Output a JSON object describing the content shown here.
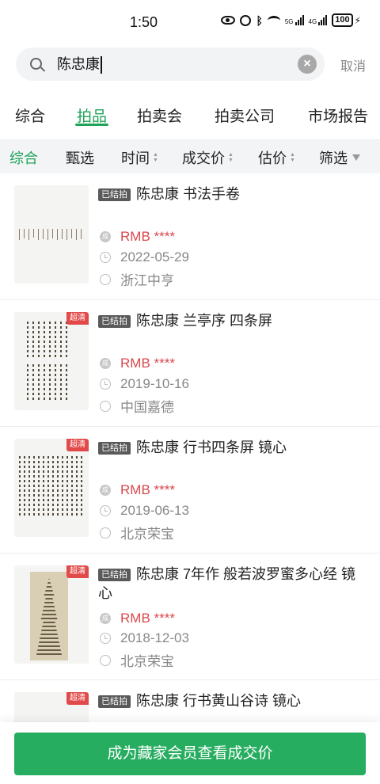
{
  "status_bar": {
    "time": "1:50",
    "network_1": "5G",
    "network_2": "4G",
    "battery": "100"
  },
  "search": {
    "query": "陈忠康",
    "clear_icon": "clear-circle-icon",
    "cancel_label": "取消"
  },
  "tabs": [
    {
      "label": "综合",
      "active": false
    },
    {
      "label": "拍品",
      "active": true
    },
    {
      "label": "拍卖会",
      "active": false
    },
    {
      "label": "拍卖公司",
      "active": false
    },
    {
      "label": "市场报告",
      "active": false
    }
  ],
  "filters": [
    {
      "label": "综合",
      "active": true
    },
    {
      "label": "甄选"
    },
    {
      "label": "时间",
      "sortable": true
    },
    {
      "label": "成交价",
      "sortable": true
    },
    {
      "label": "估价",
      "sortable": true
    },
    {
      "label": "筛选",
      "funnel": true
    }
  ],
  "items": [
    {
      "status": "已结拍",
      "title": "陈忠康 书法手卷",
      "price_icon_label": "成",
      "price": "RMB ****",
      "date": "2022-05-29",
      "auction_house": "浙江中亨",
      "hd": ""
    },
    {
      "status": "已结拍",
      "title": "陈忠康 兰亭序 四条屏",
      "price_icon_label": "成",
      "price": "RMB ****",
      "date": "2019-10-16",
      "auction_house": "中国嘉德",
      "hd": "超清"
    },
    {
      "status": "已结拍",
      "title": "陈忠康 行书四条屏 镜心",
      "price_icon_label": "成",
      "price": "RMB ****",
      "date": "2019-06-13",
      "auction_house": "北京荣宝",
      "hd": "超清"
    },
    {
      "status": "已结拍",
      "title": "陈忠康 7年作 般若波罗蜜多心经 镜心",
      "price_icon_label": "成",
      "price": "RMB ****",
      "date": "2018-12-03",
      "auction_house": "北京荣宝",
      "hd": "超清"
    },
    {
      "status": "已结拍",
      "title": "陈忠康 行书黄山谷诗 镜心",
      "hd": "超清"
    }
  ],
  "cta": {
    "label": "成为藏家会员查看成交价"
  },
  "colors": {
    "accent": "#1fa358",
    "price": "#d9474b",
    "badge": "#e24a4a",
    "cta": "#27ad5f"
  }
}
